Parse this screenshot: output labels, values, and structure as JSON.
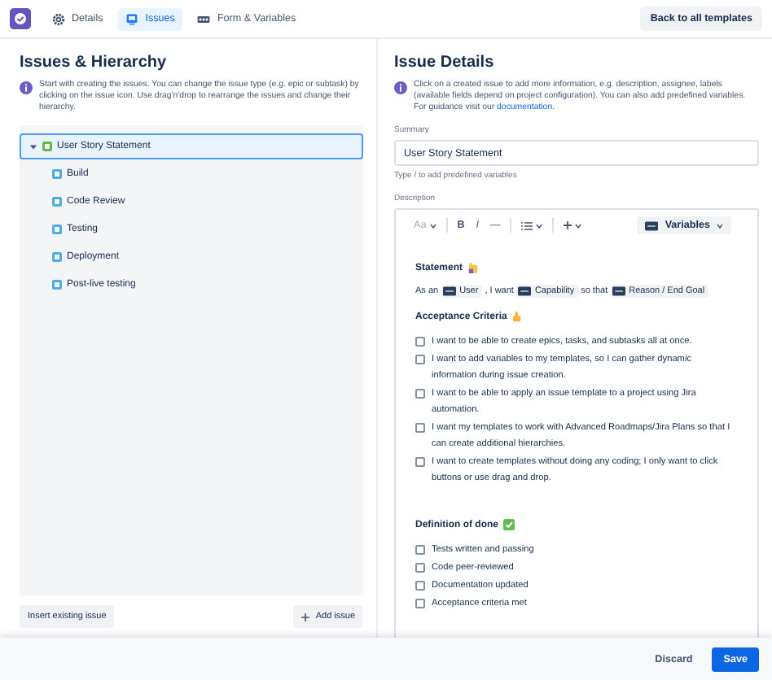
{
  "nav": {
    "tabs": [
      {
        "label": "Details",
        "kind": "gear",
        "selected": false
      },
      {
        "label": "Issues",
        "kind": "board",
        "selected": true
      },
      {
        "label": "Form & Variables",
        "kind": "form",
        "selected": false
      }
    ],
    "back_button": "Back to all templates"
  },
  "hierarchy": {
    "title": "Issues & Hierarchy",
    "info": "Start with creating the issues. You can change the issue type (e.g. epic or subtask) by clicking on the issue icon. Use drag'n'drop to rearrange the issues and change their hierarchy.",
    "tree": [
      {
        "label": "User Story Statement",
        "kind": "story",
        "expanded": true,
        "selected": true,
        "children": [
          {
            "label": "Build",
            "kind": "subtask",
            "selected": false
          },
          {
            "label": "Code Review",
            "kind": "subtask",
            "selected": false
          },
          {
            "label": "Testing",
            "kind": "subtask",
            "selected": false
          },
          {
            "label": "Deployment",
            "kind": "subtask",
            "selected": false
          },
          {
            "label": "Post-live testing",
            "kind": "subtask",
            "selected": false
          }
        ]
      }
    ],
    "insert_button": "Insert existing issue",
    "add_button": "Add issue"
  },
  "details": {
    "title": "Issue Details",
    "info": {
      "text": "Click on a created issue to add more information, e.g. description, assignee, labels (available fields depend on project configuration). You can also add predefined variables. For guidance visit our",
      "link": "documentation",
      "after": "."
    },
    "summary": {
      "label": "Summary",
      "value": "User Story Statement",
      "hint": "Type / to add predefined variables"
    },
    "description": {
      "label": "Description",
      "toolbar": {
        "text_style": "Aa",
        "bold": "B",
        "italic": "I",
        "more": "—",
        "variables": "Variables"
      },
      "blocks": [
        {
          "kind": "heading",
          "text": "Statement",
          "emoji": {
            "kind": "raised-hand"
          }
        },
        {
          "kind": "line",
          "parts": [
            {
              "kind": "text",
              "text": "As an"
            },
            {
              "kind": "variable",
              "text": "User"
            },
            {
              "kind": "text",
              "text": ", I want"
            },
            {
              "kind": "variable",
              "text": "Capability"
            },
            {
              "kind": "text",
              "text": "so that"
            },
            {
              "kind": "variable",
              "text": "Reason / End Goal"
            }
          ]
        },
        {
          "kind": "heading",
          "text": "Acceptance Criteria",
          "emoji": {
            "kind": "thumbs-up"
          }
        },
        {
          "kind": "task",
          "text": "I want to be able to create epics, tasks, and subtasks all at once.",
          "checked": false
        },
        {
          "kind": "task",
          "text": "I want to add variables to my templates, so I can gather dynamic information during issue creation.",
          "checked": false
        },
        {
          "kind": "task",
          "text": "I want to be able to apply an issue template to a project using Jira automation.",
          "checked": false
        },
        {
          "kind": "task",
          "text": "I want my templates to work with Advanced Roadmaps/Jira Plans so that I can create additional hierarchies.",
          "checked": false
        },
        {
          "kind": "task",
          "text": "I want to create templates without doing any coding; I only want to click buttons or use drag and drop.",
          "checked": false
        },
        {
          "kind": "heading",
          "text": "Definition of done",
          "emoji": {
            "kind": "check-mark"
          }
        },
        {
          "kind": "task",
          "text": "Tests written and passing",
          "checked": false
        },
        {
          "kind": "task",
          "text": "Code peer-reviewed",
          "checked": false
        },
        {
          "kind": "task",
          "text": "Documentation updated",
          "checked": false
        },
        {
          "kind": "task",
          "text": "Acceptance criteria met",
          "checked": false
        }
      ]
    }
  },
  "footer": {
    "discard": "Discard",
    "save": "Save"
  }
}
